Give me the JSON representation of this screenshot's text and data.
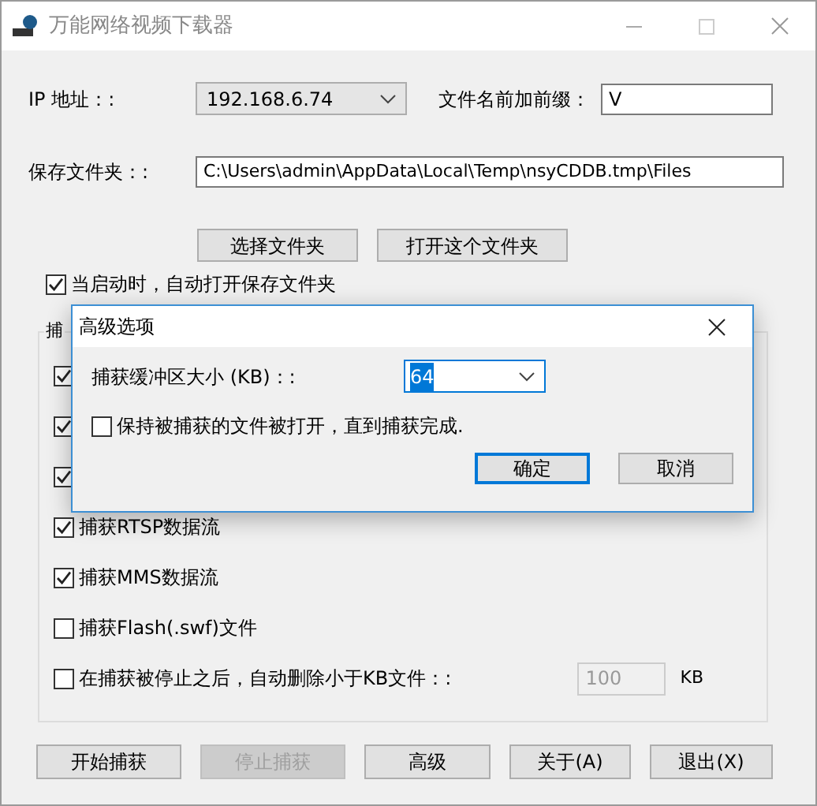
{
  "window": {
    "title": "万能网络视频下载器"
  },
  "ip": {
    "label": "IP 地址：:",
    "value": "192.168.6.74"
  },
  "prefix": {
    "label": "文件名前加前缀：",
    "value": "V"
  },
  "folder": {
    "label": "保存文件夹：:",
    "value": "C:\\Users\\admin\\AppData\\Local\\Temp\\nsyCDDB.tmp\\Files"
  },
  "folder_buttons": [
    "选择文件夹",
    "打开这个文件夹"
  ],
  "open_on_start": {
    "label": "当启动时，自动打开保存文件夹",
    "checked": true
  },
  "group": {
    "title": "捕",
    "options": [
      {
        "checked": true
      },
      {
        "checked": true
      },
      {
        "checked": true
      },
      {
        "label": "捕获RTSP数据流",
        "checked": true
      },
      {
        "label": "捕获MMS数据流",
        "checked": true
      },
      {
        "label": "捕获Flash(.swf)文件",
        "checked": false
      },
      {
        "label": "在捕获被停止之后，自动删除小于KB文件：:",
        "checked": false,
        "size": {
          "value": "100",
          "unit": "KB",
          "disabled": true
        }
      }
    ]
  },
  "buttons": [
    {
      "label": "开始捕获",
      "disabled": false
    },
    {
      "label": "停止捕获",
      "disabled": true
    },
    {
      "label": "高级",
      "disabled": false
    },
    {
      "label": "关于(A)",
      "disabled": false
    },
    {
      "label": "退出(X)",
      "disabled": false
    }
  ],
  "dialog": {
    "title": "高级选项",
    "buffer": {
      "label": "捕获缓冲区大小 (KB)：:",
      "value": "64"
    },
    "keep_open": {
      "label": "保持被捕获的文件被打开，直到捕获完成.",
      "checked": false
    },
    "buttons": [
      {
        "label": "确定",
        "default": true
      },
      {
        "label": "取消",
        "default": false
      }
    ]
  }
}
